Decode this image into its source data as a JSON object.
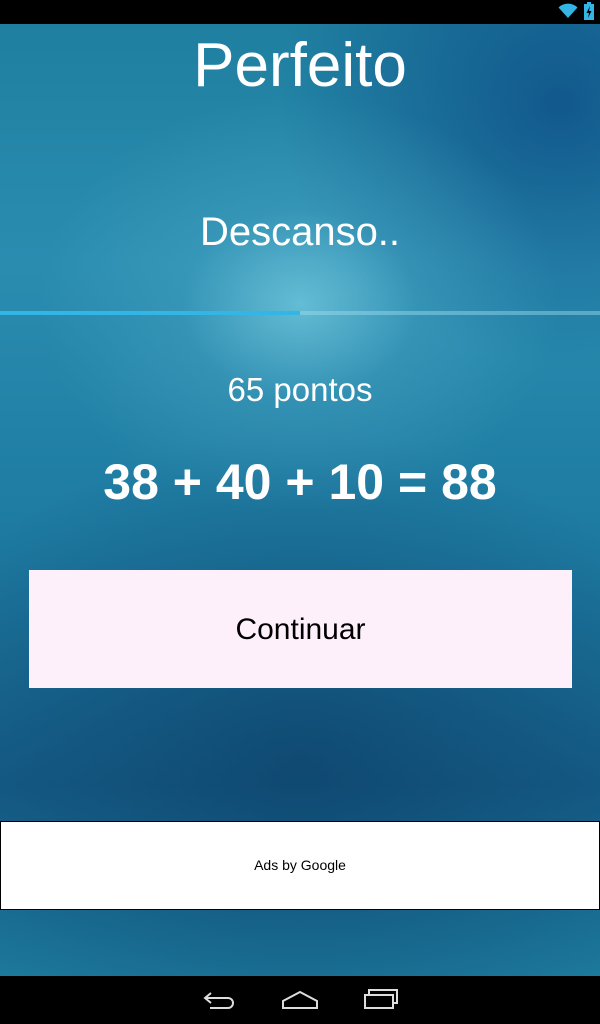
{
  "title": "Perfeito",
  "status": "Descanso..",
  "progress": 0.5,
  "points": "65 pontos",
  "equation": "38 + 40 + 10 = 88",
  "continue_label": "Continuar",
  "ad": {
    "text": "Ads by Google"
  },
  "colors": {
    "progress_fill": "#33b5e5",
    "button_bg": "#fdf0fa"
  },
  "icons": {
    "wifi": "wifi-icon",
    "battery": "battery-charging-icon",
    "back": "back-icon",
    "home": "home-icon",
    "recents": "recent-apps-icon"
  }
}
